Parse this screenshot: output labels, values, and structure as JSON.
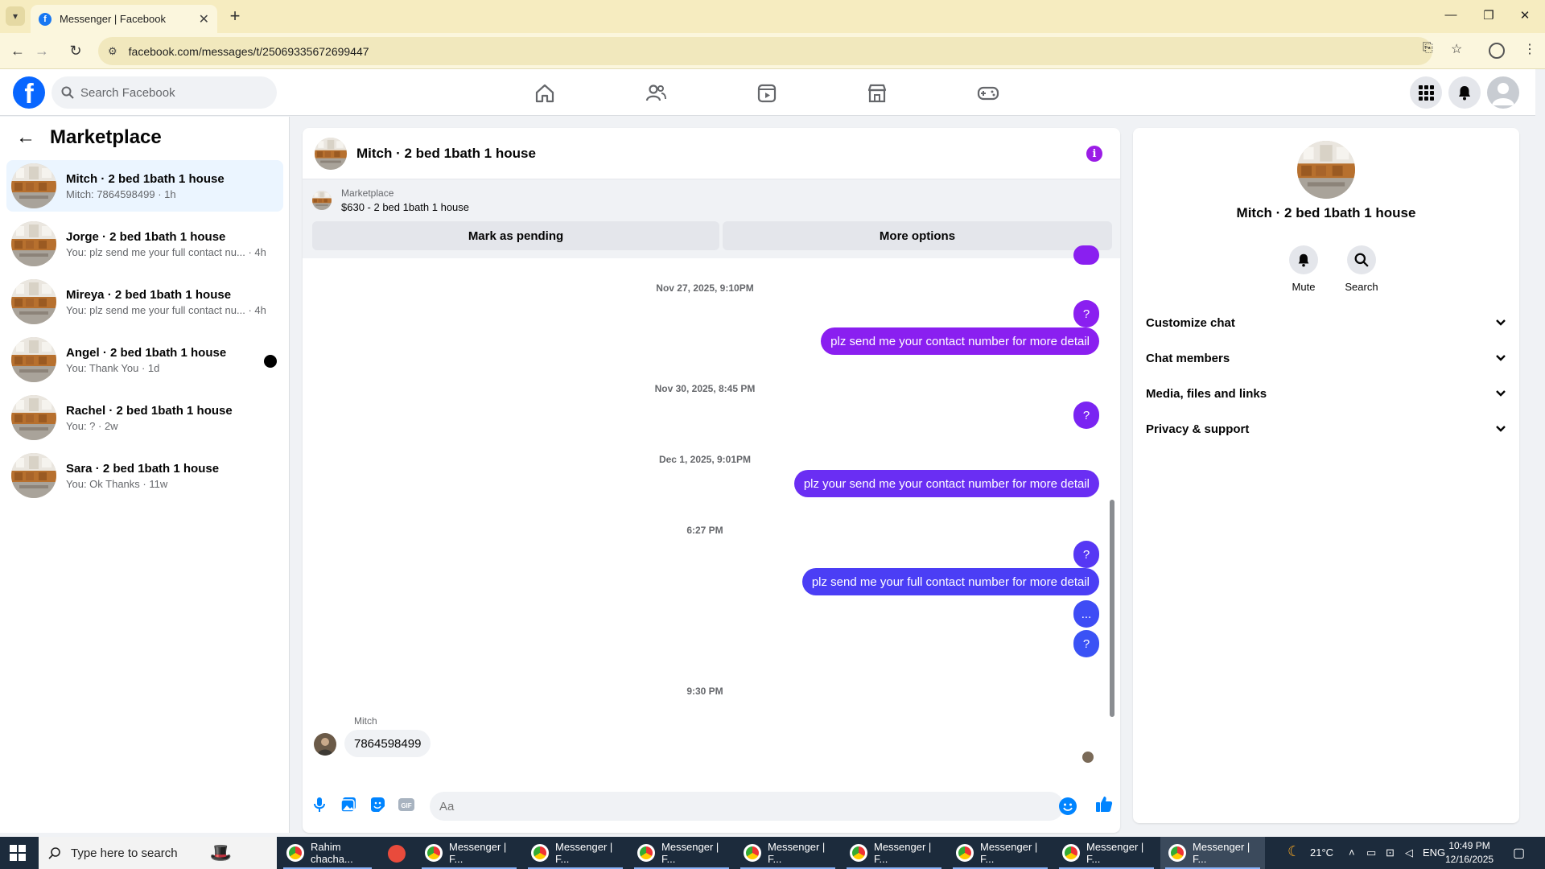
{
  "browser": {
    "tab_title": "Messenger | Facebook",
    "url": "facebook.com/messages/t/25069335672699447"
  },
  "fb": {
    "search_placeholder": "Search Facebook"
  },
  "sidebar": {
    "title": "Marketplace",
    "conversations": [
      {
        "name": "Mitch · 2 bed 1bath 1 house",
        "preview": "Mitch: 7864598499 · 1h",
        "active": true,
        "unread": false
      },
      {
        "name": "Jorge · 2 bed 1bath 1 house",
        "preview": "You: plz send me your full contact nu...",
        "time": "· 4h",
        "active": false,
        "unread": false
      },
      {
        "name": "Mireya · 2 bed 1bath 1 house",
        "preview": "You: plz send me your full contact nu...",
        "time": "· 4h",
        "active": false,
        "unread": false
      },
      {
        "name": "Angel · 2 bed 1bath 1 house",
        "preview": "You: Thank You · 1d",
        "active": false,
        "unread": true
      },
      {
        "name": "Rachel · 2 bed 1bath 1 house",
        "preview": "You: ? · 2w",
        "active": false,
        "unread": false
      },
      {
        "name": "Sara · 2 bed 1bath 1 house",
        "preview": "You: Ok Thanks · 11w",
        "active": false,
        "unread": false
      }
    ]
  },
  "chat": {
    "title": "Mitch · 2 bed 1bath 1 house",
    "marketplace_label": "Marketplace",
    "listing": "$630 - 2 bed 1bath 1 house",
    "mark_pending": "Mark as pending",
    "more_options": "More options",
    "timestamps": [
      "Nov 27, 2025, 9:10PM",
      "Nov 30, 2025, 8:45 PM",
      "Dec 1, 2025, 9:01PM",
      "6:27 PM",
      "9:30 PM"
    ],
    "outgoing": [
      "?",
      "plz send me your contact number for more detail",
      "?",
      "plz your send me your contact number for more detail",
      "?",
      "plz send me your  full contact number for more detail",
      "...",
      "?"
    ],
    "incoming_sender": "Mitch",
    "incoming_message": "7864598499",
    "composer_placeholder": "Aa",
    "colors": {
      "bubble_purple": "#8a1ff0",
      "bubble_blue": "#3e4cf5",
      "accent": "#0084ff"
    }
  },
  "info_panel": {
    "name": "Mitch · 2 bed 1bath 1 house",
    "mute": "Mute",
    "search": "Search",
    "sections": [
      "Customize chat",
      "Chat members",
      "Media, files and links",
      "Privacy & support"
    ]
  },
  "taskbar": {
    "search_placeholder": "Type here to search",
    "items": [
      "Rahim chacha...",
      "Messenger | F...",
      "Messenger | F...",
      "Messenger | F...",
      "Messenger | F...",
      "Messenger | F...",
      "Messenger | F...",
      "Messenger | F...",
      "Messenger | F..."
    ],
    "weather": "21°C",
    "lang": "ENG",
    "time": "10:49 PM",
    "date": "12/16/2025"
  }
}
